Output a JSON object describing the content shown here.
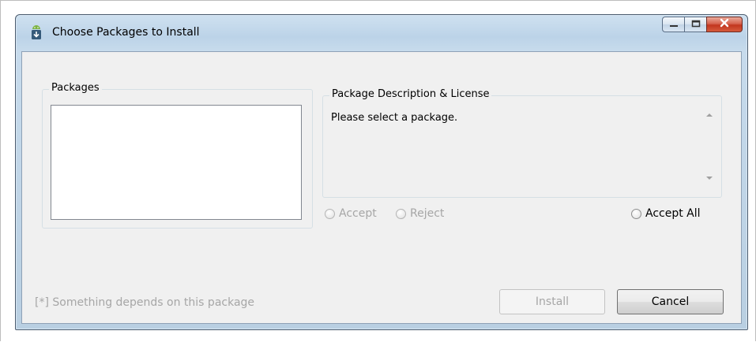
{
  "window": {
    "title": "Choose Packages to Install",
    "icon": "android-download-icon",
    "controls": [
      "minimize-icon",
      "maximize-icon",
      "close-icon"
    ]
  },
  "packages": {
    "label": "Packages",
    "items": []
  },
  "description": {
    "label": "Package Description & License",
    "text": "Please select a package."
  },
  "license_options": {
    "accept": "Accept",
    "reject": "Reject",
    "accept_all": "Accept All"
  },
  "footnote": "[*] Something depends on this package",
  "buttons": {
    "install": "Install",
    "cancel": "Cancel"
  },
  "colors": {
    "title_bar": "#bcd3e8",
    "dialog_bg": "#f0f0f0",
    "close_button": "#c2361f",
    "disabled_text": "#a6a6a6"
  }
}
